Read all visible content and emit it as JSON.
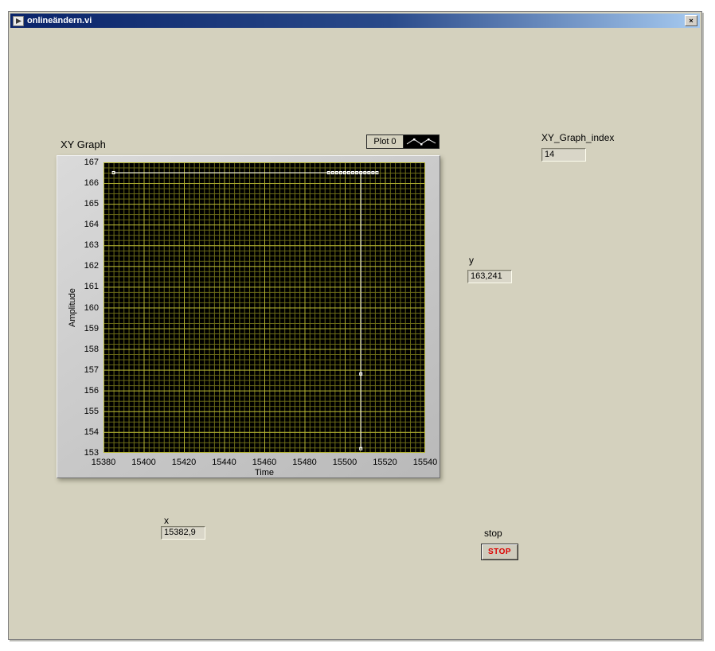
{
  "window": {
    "title": "onlineändern.vi",
    "close_button": "×"
  },
  "colors": {
    "panel": "#d4d1be",
    "titlebar_left": "#0a246a",
    "titlebar_right": "#a6caf0",
    "plot_background": "#000000",
    "grid_minor": "#6e6e18",
    "grid_major": "#b2b232",
    "plot_line": "#ffffff",
    "stop_text": "#dd0000"
  },
  "graph": {
    "label": "XY Graph",
    "legend": {
      "plot_name": "Plot 0"
    },
    "x_axis_label": "Time",
    "y_axis_label": "Amplitude"
  },
  "indicators": {
    "index": {
      "label": "XY_Graph_index",
      "value": "14"
    },
    "y": {
      "label": "y",
      "value": "163,241"
    },
    "x": {
      "label": "x",
      "value": "15382,9"
    }
  },
  "stop": {
    "label": "stop",
    "button_text": "STOP"
  },
  "chart_data": {
    "type": "line",
    "title": "XY Graph",
    "xlabel": "Time",
    "ylabel": "Amplitude",
    "xlim": [
      15380,
      15540
    ],
    "ylim": [
      153,
      167
    ],
    "x_ticks": [
      15380,
      15400,
      15420,
      15440,
      15460,
      15480,
      15500,
      15520,
      15540
    ],
    "y_ticks": [
      153,
      154,
      155,
      156,
      157,
      158,
      159,
      160,
      161,
      162,
      163,
      164,
      165,
      166,
      167
    ],
    "grid": true,
    "legend_position": "top-right",
    "series": [
      {
        "name": "Plot 0",
        "color": "#ffffff",
        "marker": "square",
        "points": [
          [
            15385,
            166.5
          ],
          [
            15492,
            166.5
          ],
          [
            15494,
            166.5
          ],
          [
            15496,
            166.5
          ],
          [
            15498,
            166.5
          ],
          [
            15500,
            166.5
          ],
          [
            15502,
            166.5
          ],
          [
            15504,
            166.5
          ],
          [
            15506,
            166.5
          ],
          [
            15508,
            166.5
          ],
          [
            15510,
            166.5
          ],
          [
            15512,
            166.5
          ],
          [
            15514,
            166.5
          ],
          [
            15516,
            166.5
          ],
          [
            15508,
            156.8
          ],
          [
            15508,
            153.2
          ]
        ],
        "polylines": [
          [
            [
              15385,
              166.5
            ],
            [
              15516,
              166.5
            ]
          ],
          [
            [
              15508,
              166.5
            ],
            [
              15508,
              156.8
            ],
            [
              15508,
              153.2
            ]
          ]
        ]
      }
    ]
  }
}
